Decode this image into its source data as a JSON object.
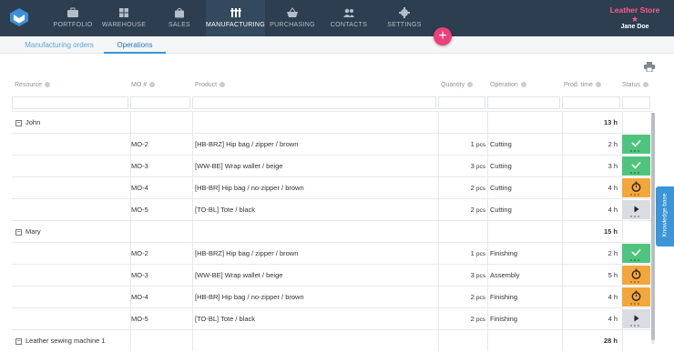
{
  "nav": {
    "items": [
      {
        "label": "PORTFOLIO",
        "icon": "briefcase-icon"
      },
      {
        "label": "WAREHOUSE",
        "icon": "grid-icon"
      },
      {
        "label": "SALES",
        "icon": "bag-icon"
      },
      {
        "label": "MANUFACTURING",
        "icon": "tools-icon"
      },
      {
        "label": "PURCHASING",
        "icon": "basket-icon"
      },
      {
        "label": "CONTACTS",
        "icon": "people-icon"
      },
      {
        "label": "SETTINGS",
        "icon": "gear-icon"
      }
    ],
    "active": "MANUFACTURING"
  },
  "account": {
    "store": "Leather Store",
    "user": "Jane Doe"
  },
  "subtabs": [
    {
      "label": "Manufacturing orders"
    },
    {
      "label": "Operations"
    }
  ],
  "columns": {
    "resource": "Resource",
    "mo": "MO #",
    "product": "Product",
    "quantity": "Quantity",
    "operation": "Operation",
    "prod_time": "Prod. time",
    "status": "Status"
  },
  "groups": [
    {
      "name": "John",
      "total": "13 h",
      "rows": [
        {
          "mo": "MO-2",
          "product": "[HB-BRZ] Hip bag  / zipper / brown",
          "qty": "1",
          "unit": "pcs",
          "operation": "Cutting",
          "time": "2 h",
          "status": "done"
        },
        {
          "mo": "MO-3",
          "product": "[WW-BE] Wrap wallet  / beige",
          "qty": "3",
          "unit": "pcs",
          "operation": "Cutting",
          "time": "3 h",
          "status": "done"
        },
        {
          "mo": "MO-4",
          "product": "[HB-BR] Hip bag  / no-zipper / brown",
          "qty": "2",
          "unit": "pcs",
          "operation": "Cutting",
          "time": "4 h",
          "status": "in-progress"
        },
        {
          "mo": "MO-5",
          "product": "[TO-BL] Tote  / black",
          "qty": "2",
          "unit": "pcs",
          "operation": "Cutting",
          "time": "4 h",
          "status": "not-started"
        }
      ]
    },
    {
      "name": "Mary",
      "total": "15 h",
      "rows": [
        {
          "mo": "MO-2",
          "product": "[HB-BRZ] Hip bag  / zipper / brown",
          "qty": "1",
          "unit": "pcs",
          "operation": "Finishing",
          "time": "2 h",
          "status": "done"
        },
        {
          "mo": "MO-3",
          "product": "[WW-BE] Wrap wallet  / beige",
          "qty": "3",
          "unit": "pcs",
          "operation": "Assembly",
          "time": "5 h",
          "status": "in-progress"
        },
        {
          "mo": "MO-4",
          "product": "[HB-BR] Hip bag  / no-zipper / brown",
          "qty": "2",
          "unit": "pcs",
          "operation": "Finishing",
          "time": "4 h",
          "status": "in-progress"
        },
        {
          "mo": "MO-5",
          "product": "[TO-BL] Tote  / black",
          "qty": "2",
          "unit": "pcs",
          "operation": "Finishing",
          "time": "4 h",
          "status": "not-started"
        }
      ]
    },
    {
      "name": "Leather sewing machine 1",
      "total": "28 h",
      "rows": []
    }
  ],
  "knowledge_base": "Knowledge base",
  "colors": {
    "nav_bg": "#2c3e50",
    "accent": "#ec407a",
    "link": "#3b95d6",
    "done": "#4fc47f",
    "in_progress": "#f4a63a",
    "not_started": "#d9dde1"
  }
}
